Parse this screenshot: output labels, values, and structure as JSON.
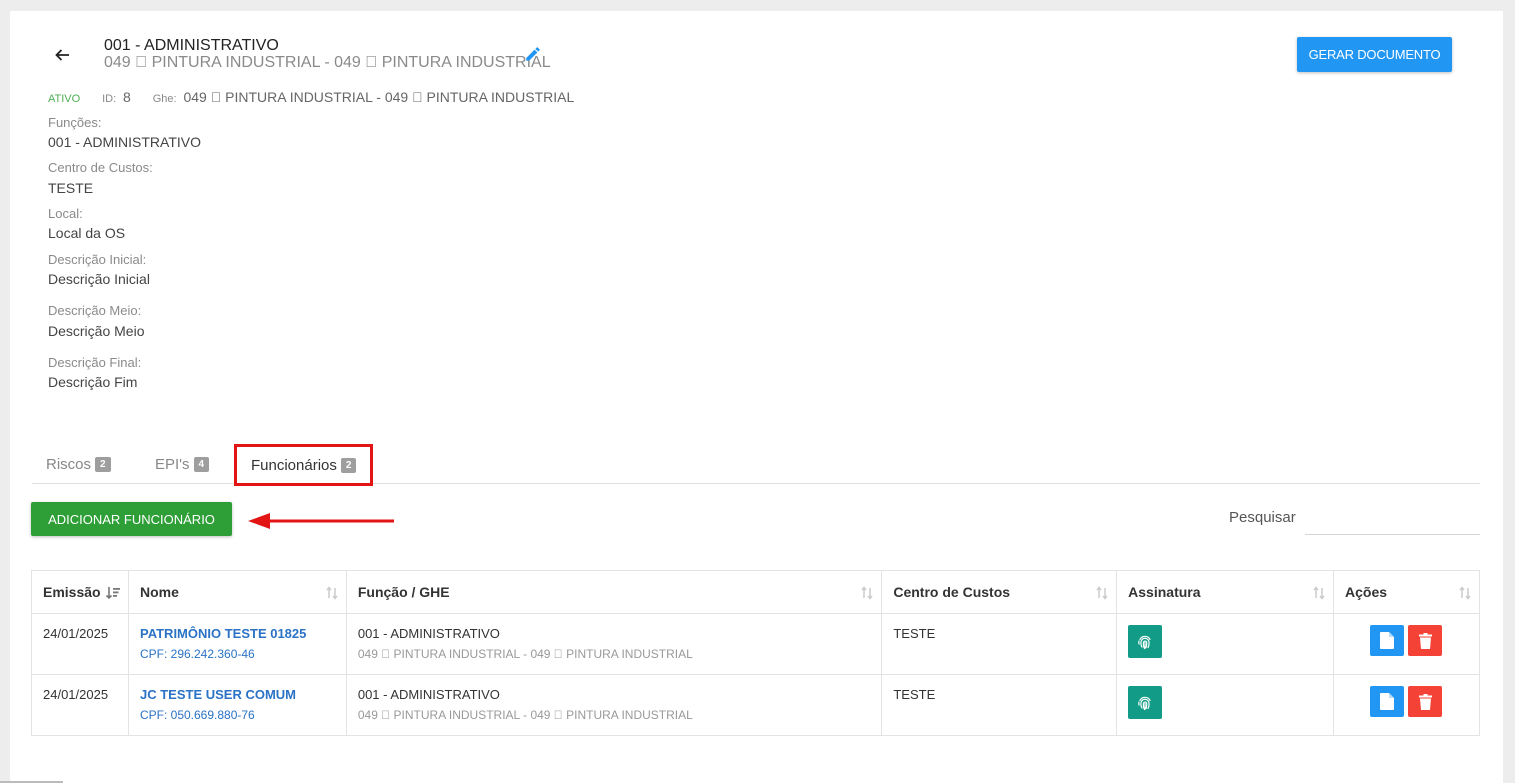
{
  "header": {
    "title": "001 - ADMINISTRATIVO",
    "subtitle": "049  PINTURA INDUSTRIAL - 049  PINTURA INDUSTRIAL",
    "generate_button": "GERAR DOCUMENTO",
    "back_icon": "arrow-left-icon",
    "edit_icon": "pencil-icon"
  },
  "meta": {
    "status": "ATIVO",
    "id_label": "ID:",
    "id_value": "8",
    "ghe_label": "Ghe:",
    "ghe_value": "049  PINTURA INDUSTRIAL - 049  PINTURA INDUSTRIAL"
  },
  "fields": [
    {
      "label": "Funções:",
      "value": "001 - ADMINISTRATIVO"
    },
    {
      "label": "Centro de Custos:",
      "value": "TESTE"
    },
    {
      "label": "Local:",
      "value": "Local da OS"
    },
    {
      "label": "Descrição Inicial:",
      "value": "Descrição Inicial"
    },
    {
      "label": "Descrição Meio:",
      "value": "Descrição Meio"
    },
    {
      "label": "Descrição Final:",
      "value": "Descrição Fim"
    }
  ],
  "tabs": [
    {
      "label": "Riscos",
      "count": "2"
    },
    {
      "label": "EPI's",
      "count": "4"
    },
    {
      "label": "Funcionários",
      "count": "2",
      "active": true
    }
  ],
  "toolbar": {
    "add_button": "ADICIONAR FUNCIONÁRIO",
    "search_label": "Pesquisar",
    "search_value": ""
  },
  "table": {
    "columns": [
      "Emissão",
      "Nome",
      "Função / GHE",
      "Centro de Custos",
      "Assinatura",
      "Ações"
    ],
    "rows": [
      {
        "emissao": "24/01/2025",
        "nome": "PATRIMÔNIO TESTE 01825",
        "cpf": "CPF: 296.242.360-46",
        "funcao": "001 - ADMINISTRATIVO",
        "ghe": "049  PINTURA INDUSTRIAL - 049  PINTURA INDUSTRIAL",
        "centro": "TESTE"
      },
      {
        "emissao": "24/01/2025",
        "nome": "JC TESTE USER COMUM",
        "cpf": "CPF: 050.669.880-76",
        "funcao": "001 - ADMINISTRATIVO",
        "ghe": "049  PINTURA INDUSTRIAL - 049  PINTURA INDUSTRIAL",
        "centro": "TESTE"
      }
    ]
  },
  "colors": {
    "primary": "#2196f3",
    "success": "#2e9f37",
    "signature": "#129b86",
    "danger": "#f44336",
    "highlight": "#e21414",
    "link": "#2a72c5"
  }
}
